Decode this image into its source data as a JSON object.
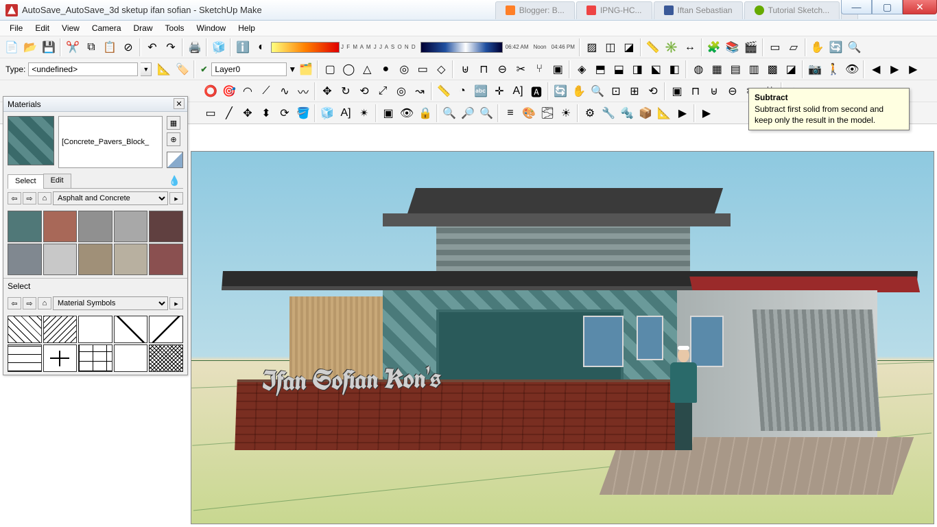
{
  "titlebar": {
    "title": "AutoSave_AutoSave_3d sketup ifan sofian - SketchUp Make",
    "tabs": [
      {
        "label": "Blogger: B...",
        "cls": "blogger"
      },
      {
        "label": "IPNG-HC...",
        "cls": "png"
      },
      {
        "label": "Iftan Sebastian",
        "cls": "fb"
      },
      {
        "label": "Tutorial Sketch...",
        "cls": "tut"
      },
      {
        "label": "+",
        "cls": "new"
      }
    ]
  },
  "menu": [
    "File",
    "Edit",
    "View",
    "Camera",
    "Draw",
    "Tools",
    "Window",
    "Help"
  ],
  "row2": {
    "type_label": "Type:",
    "type_value": "<undefined>",
    "layer_value": "Layer0",
    "months": "J F M A M J J A S O N D",
    "time1": "06:42 AM",
    "time2": "Noon",
    "time3": "04:46 PM"
  },
  "tooltip": {
    "title": "Subtract",
    "body": "Subtract first solid from second and keep only the result in the model."
  },
  "materials": {
    "hdr": "Materials",
    "name": "[Concrete_Pavers_Block_",
    "tab_select": "Select",
    "tab_edit": "Edit",
    "lib1": "Asphalt and Concrete",
    "sel_label": "Select",
    "lib2": "Material Symbols"
  },
  "model": {
    "sign": "Ifan Sofian Kon's"
  }
}
